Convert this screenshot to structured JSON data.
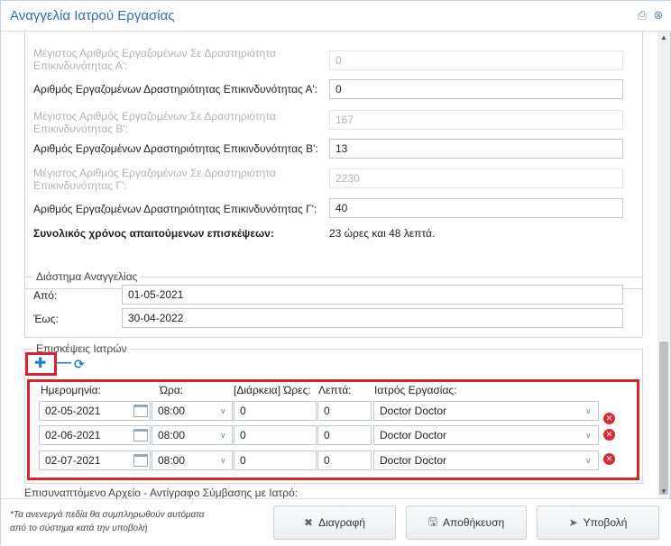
{
  "window": {
    "title": "Αναγγελία Ιατρού Εργασίας"
  },
  "risk": {
    "max_a_label": "Μέγιστος Αριθμός Εργαζομένων Σε Δραστηριότητα Επικινδυνότητας Α':",
    "max_a_value": "0",
    "count_a_label": "Αριθμός Εργαζομένων Δραστηριότητας Επικινδυνότητας Α':",
    "count_a_value": "0",
    "max_b_label": "Μέγιστος Αριθμός Εργαζομένων Σε Δραστηριότητα Επικινδυνότητας Β':",
    "max_b_value": "167",
    "count_b_label": "Αριθμός Εργαζομένων Δραστηριότητας Επικινδυνότητας Β':",
    "count_b_value": "13",
    "max_c_label": "Μέγιστος Αριθμός Εργαζομένων Σε Δραστηριότητα Επικινδυνότητας Γ':",
    "max_c_value": "2230",
    "count_c_label": "Αριθμός Εργαζομένων Δραστηριότητας Επικινδυνότητας Γ':",
    "count_c_value": "40",
    "total_label": "Συνολικός χρόνος απαιτούμενων επισκέψεων:",
    "total_value": "23 ώρες και 48 λεπτά."
  },
  "period": {
    "legend": "Διάστημα Αναγγελίας",
    "from_label": "Από:",
    "from_value": "01-05-2021",
    "to_label": "Έως:",
    "to_value": "30-04-2022"
  },
  "visits": {
    "legend": "Επισκέψεις Ιατρών",
    "headers": {
      "date": "Ημερομηνία:",
      "time": "Ώρα:",
      "hours": "[Διάρκεια] Ώρες:",
      "minutes": "Λεπτά:",
      "doctor": "Ιατρός Εργασίας:"
    },
    "rows": [
      {
        "date": "02-05-2021",
        "time": "08:00",
        "hours": "0",
        "minutes": "0",
        "doctor": "Doctor Doctor"
      },
      {
        "date": "02-06-2021",
        "time": "08:00",
        "hours": "0",
        "minutes": "0",
        "doctor": "Doctor Doctor"
      },
      {
        "date": "02-07-2021",
        "time": "08:00",
        "hours": "0",
        "minutes": "0",
        "doctor": "Doctor Doctor"
      }
    ]
  },
  "attachment": {
    "label": "Επισυναπτόμενο Αρχείο - Αντίγραφο Σύμβασης με Ιατρό:"
  },
  "footer": {
    "note": "*Τα ανενεργά πεδία θα συμπληρωθούν αυτόματα από το σύστημα κατά την υποβολή",
    "delete_label": "Διαγραφή",
    "save_label": "Αποθήκευση",
    "submit_label": "Υποβολή"
  },
  "colors": {
    "accent": "#2f6fad",
    "highlight": "#d9232e",
    "add": "#1a7fd4"
  }
}
